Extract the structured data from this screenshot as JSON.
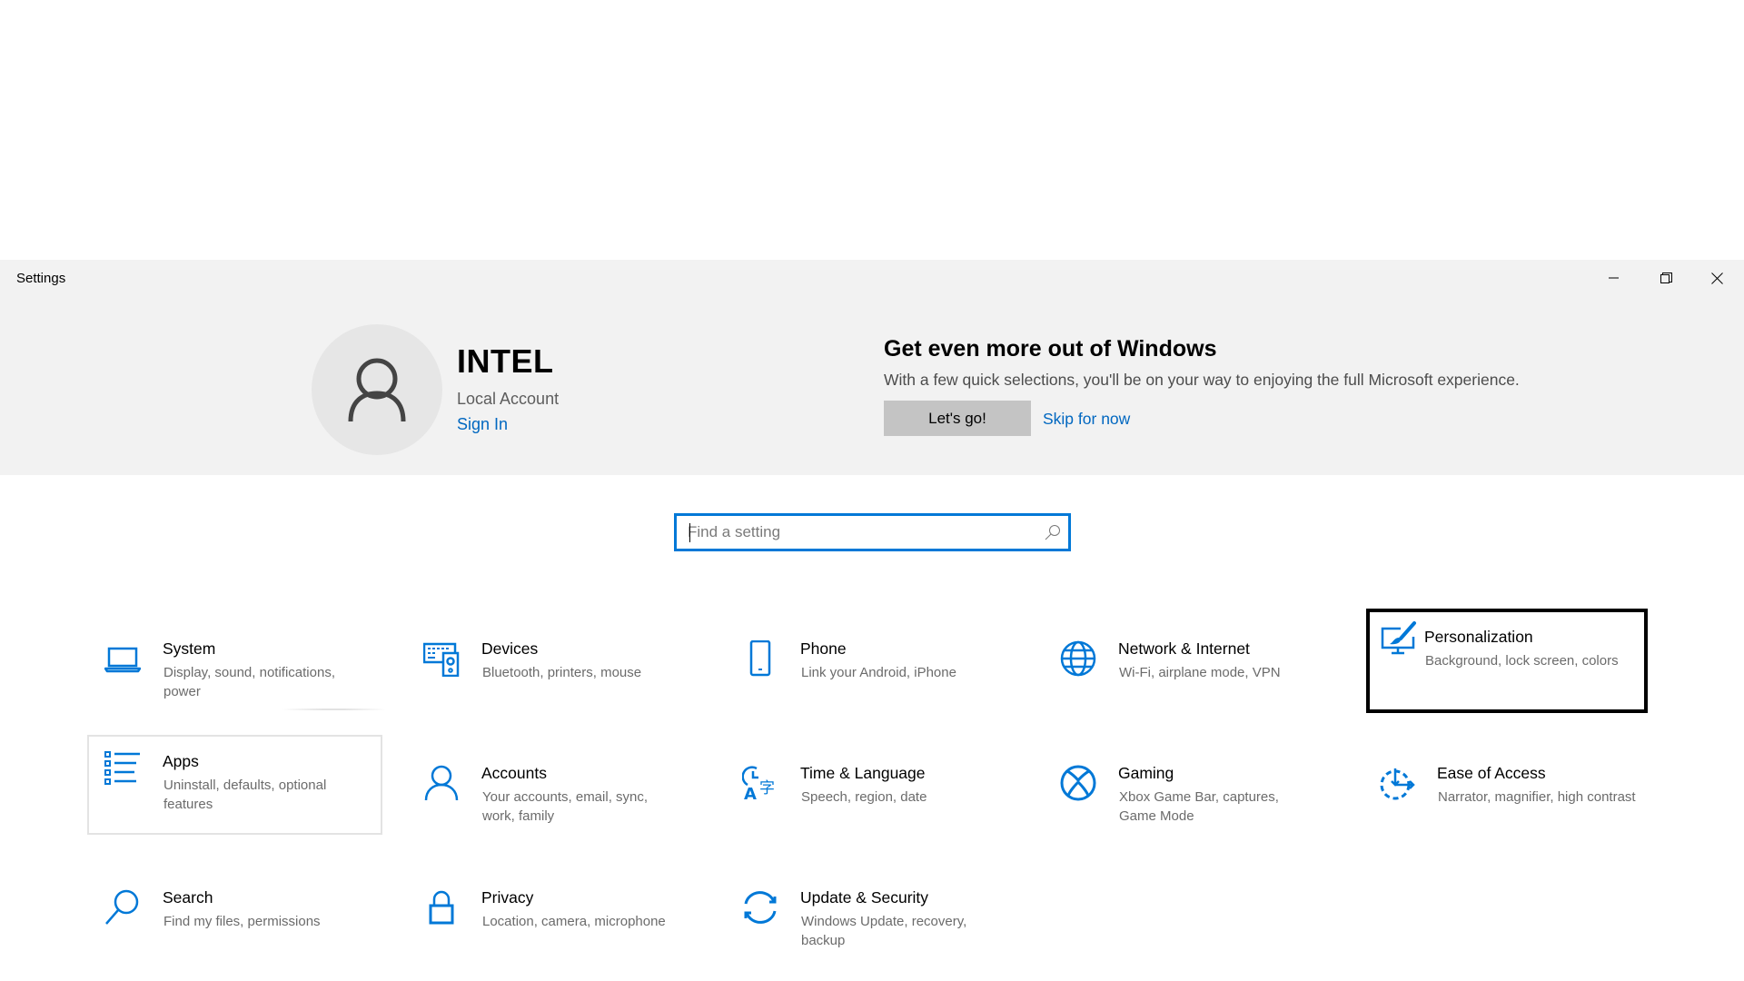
{
  "window": {
    "title": "Settings",
    "controls": {
      "minimize": "minimize",
      "maximize": "restore",
      "close": "close"
    }
  },
  "account": {
    "name": "INTEL",
    "type": "Local Account",
    "sign_in": "Sign In",
    "avatar_icon": "person-icon"
  },
  "promo": {
    "title": "Get even more out of Windows",
    "text": "With a few quick selections, you'll be on your way to enjoying the full Microsoft experience.",
    "primary_button": "Let's go!",
    "secondary_link": "Skip for now"
  },
  "search": {
    "placeholder": "Find a setting",
    "value": ""
  },
  "colors": {
    "accent": "#0078d7",
    "link": "#0067c0",
    "header_bg": "#f2f2f2",
    "button_bg": "#c4c4c4"
  },
  "categories": [
    {
      "title": "System",
      "desc": "Display, sound, notifications, power",
      "icon": "laptop-icon"
    },
    {
      "title": "Devices",
      "desc": "Bluetooth, printers, mouse",
      "icon": "devices-icon"
    },
    {
      "title": "Phone",
      "desc": "Link your Android, iPhone",
      "icon": "phone-icon"
    },
    {
      "title": "Network & Internet",
      "desc": "Wi-Fi, airplane mode, VPN",
      "icon": "globe-icon"
    },
    {
      "title": "Personalization",
      "desc": "Background, lock screen, colors",
      "icon": "paintbrush-monitor-icon",
      "focused": true
    },
    {
      "title": "Apps",
      "desc": "Uninstall, defaults, optional features",
      "icon": "apps-list-icon",
      "hovered": true
    },
    {
      "title": "Accounts",
      "desc": "Your accounts, email, sync, work, family",
      "icon": "person-icon"
    },
    {
      "title": "Time & Language",
      "desc": "Speech, region, date",
      "icon": "time-language-icon"
    },
    {
      "title": "Gaming",
      "desc": "Xbox Game Bar, captures, Game Mode",
      "icon": "xbox-icon"
    },
    {
      "title": "Ease of Access",
      "desc": "Narrator, magnifier, high contrast",
      "icon": "ease-of-access-icon"
    },
    {
      "title": "Search",
      "desc": "Find my files, permissions",
      "icon": "search-icon"
    },
    {
      "title": "Privacy",
      "desc": "Location, camera, microphone",
      "icon": "lock-icon"
    },
    {
      "title": "Update & Security",
      "desc": "Windows Update, recovery, backup",
      "icon": "sync-icon"
    }
  ]
}
